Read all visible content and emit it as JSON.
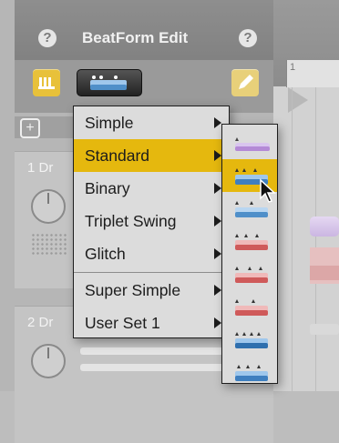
{
  "panel": {
    "title": "BeatForm Edit",
    "help_left": "?",
    "help_right": "?",
    "add_symbol": "+"
  },
  "timeline": {
    "ruler_number": "1"
  },
  "tracks": [
    {
      "label": "1 Dr"
    },
    {
      "label": "2 Dr"
    }
  ],
  "menu": {
    "items": [
      {
        "label": "Simple",
        "has_submenu": true,
        "active": false
      },
      {
        "label": "Standard",
        "has_submenu": true,
        "active": true
      },
      {
        "label": "Binary",
        "has_submenu": true,
        "active": false
      },
      {
        "label": "Triplet Swing",
        "has_submenu": true,
        "active": false
      },
      {
        "label": "Glitch",
        "has_submenu": true,
        "active": false
      },
      {
        "label": "Super Simple",
        "has_submenu": true,
        "active": false
      },
      {
        "label": "User Set 1",
        "has_submenu": true,
        "active": false
      }
    ]
  },
  "submenu": {
    "patterns": [
      {
        "icon": "pattern-purple-single-icon",
        "color": "#b48ad6",
        "active": false
      },
      {
        "icon": "pattern-blue-double-icon",
        "color": "#4f8fc9",
        "active": true
      },
      {
        "icon": "pattern-blue-double-icon",
        "color": "#4f8fc9",
        "active": false
      },
      {
        "icon": "pattern-red-triple-icon",
        "color": "#cf5a5a",
        "active": false
      },
      {
        "icon": "pattern-red-triple-icon",
        "color": "#cf5a5a",
        "active": false
      },
      {
        "icon": "pattern-red-double-icon",
        "color": "#cf5a5a",
        "active": false
      },
      {
        "icon": "pattern-blue-quad-icon",
        "color": "#4f8fc9",
        "active": false
      },
      {
        "icon": "pattern-blue-triple-icon",
        "color": "#4f8fc9",
        "active": false
      }
    ]
  },
  "colors": {
    "accent": "#e5b80e",
    "menu_bg": "#dcdcdc"
  }
}
